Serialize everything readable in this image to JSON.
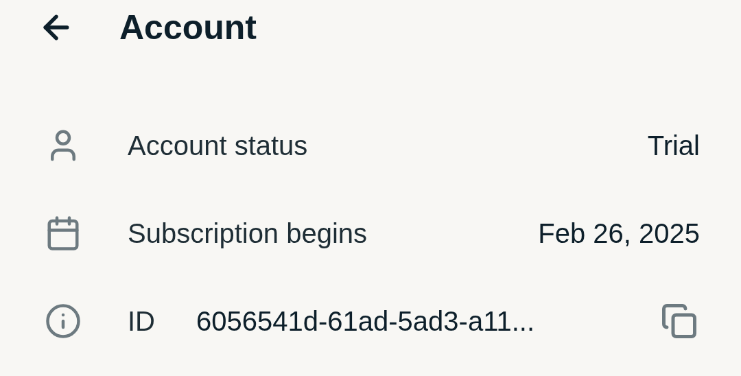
{
  "header": {
    "title": "Account"
  },
  "rows": [
    {
      "kind": "status",
      "label": "Account status",
      "value": "Trial"
    },
    {
      "kind": "date",
      "label": "Subscription begins",
      "value": "Feb 26, 2025"
    },
    {
      "kind": "id",
      "label": "ID",
      "value": "6056541d-61ad-5ad3-a11..."
    }
  ]
}
